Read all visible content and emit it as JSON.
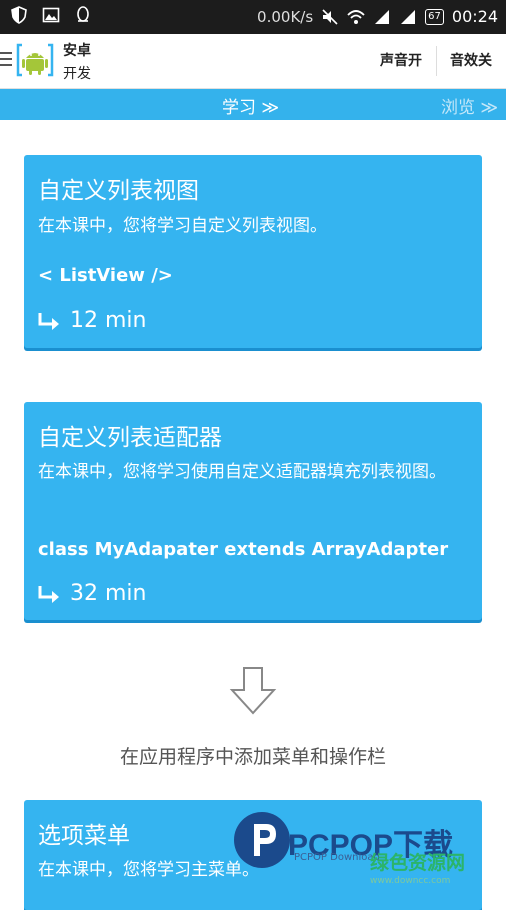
{
  "status_bar": {
    "net_speed": "0.00K/s",
    "battery": "67",
    "time": "00:24"
  },
  "action_bar": {
    "app_name_line1": "安卓",
    "app_name_line2": "开发",
    "sound_button": "声音开",
    "effects_button": "音效关"
  },
  "tabs": {
    "learn": "学习 ≫",
    "browse": "浏览 ≫"
  },
  "lessons": [
    {
      "title": "自定义列表视图",
      "description": "在本课中，您将学习自定义列表视图。",
      "code": "< ListView />",
      "duration": "12 min"
    },
    {
      "title": "自定义列表适配器",
      "description": "在本课中，您将学习使用自定义适配器填充列表视图。",
      "code": "class MyAdapater extends ArrayAdapter",
      "duration": "32 min"
    },
    {
      "title": "选项菜单",
      "description": "在本课中，您将学习主菜单。"
    }
  ],
  "section_label": "在应用程序中添加菜单和操作栏",
  "watermark": {
    "brand": "PCPOP下载",
    "sub": "PCPOP Download",
    "green_text": "绿色资源网",
    "url": "www.downcc.com"
  },
  "colors": {
    "status_bar": "#1c1c1c",
    "tab_strip": "#34b2ec",
    "card": "#35b4f0",
    "card_shadow": "#1a8fcf"
  }
}
